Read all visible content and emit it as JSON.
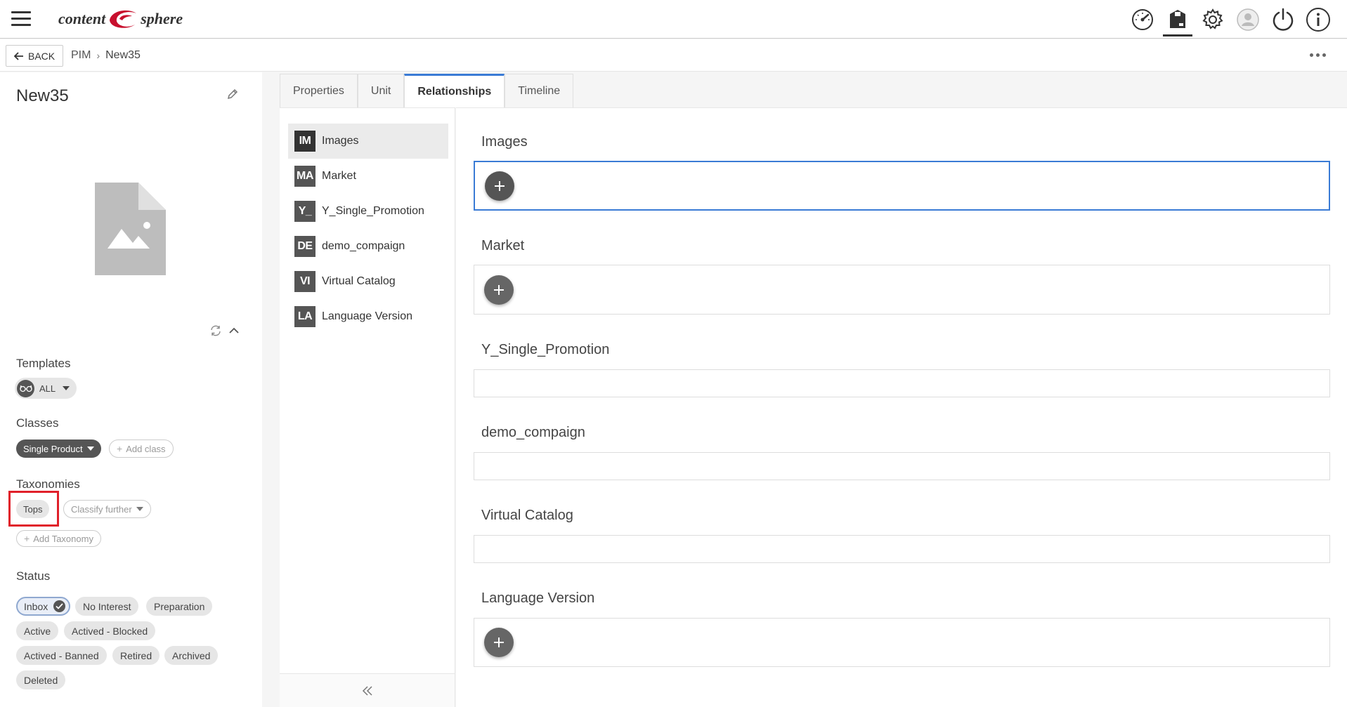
{
  "header": {
    "logo_left": "content",
    "logo_right": "sphere",
    "icons": [
      "dashboard-gauge-icon",
      "products-box-icon",
      "settings-gear-icon",
      "user-avatar-icon",
      "power-icon",
      "info-icon"
    ]
  },
  "subbar": {
    "back_label": "BACK",
    "breadcrumb": [
      "PIM",
      "New35"
    ]
  },
  "product": {
    "title": "New35",
    "templates_label": "Templates",
    "template_value": "ALL",
    "classes_label": "Classes",
    "class_value": "Single Product",
    "add_class_label": "Add class",
    "taxonomies_label": "Taxonomies",
    "taxonomy_value": "Tops",
    "classify_further_label": "Classify further",
    "add_taxonomy_label": "Add Taxonomy",
    "status_label": "Status",
    "statuses": [
      "Inbox",
      "No Interest",
      "Preparation",
      "Active",
      "Actived - Blocked",
      "Actived - Banned",
      "Retired",
      "Archived",
      "Deleted"
    ],
    "selected_status": "Inbox"
  },
  "tabs": [
    "Properties",
    "Unit",
    "Relationships",
    "Timeline"
  ],
  "active_tab": "Relationships",
  "relationships": [
    {
      "abbr": "IM",
      "label": "Images"
    },
    {
      "abbr": "MA",
      "label": "Market"
    },
    {
      "abbr": "Y_",
      "label": "Y_Single_Promotion"
    },
    {
      "abbr": "DE",
      "label": "demo_compaign"
    },
    {
      "abbr": "VI",
      "label": "Virtual Catalog"
    },
    {
      "abbr": "LA",
      "label": "Language Version"
    }
  ],
  "sections": [
    "Images",
    "Market",
    "Y_Single_Promotion",
    "demo_compaign",
    "Virtual Catalog",
    "Language Version"
  ],
  "colors": {
    "accent": "#3a7bd5",
    "highlight": "#e0202a",
    "logo_red": "#c8102e"
  }
}
